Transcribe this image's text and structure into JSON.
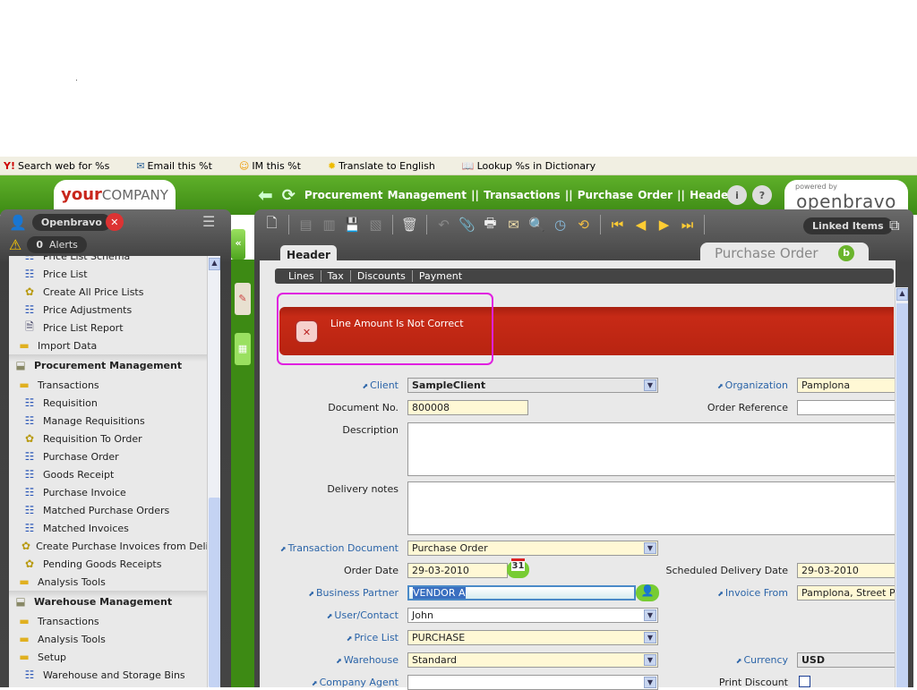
{
  "browser_toolbar": [
    {
      "icon": "yahoo-icon",
      "label": "Search web for %s"
    },
    {
      "icon": "email-icon",
      "label": "Email this %t"
    },
    {
      "icon": "smiley-icon",
      "label": "IM this %t"
    },
    {
      "icon": "translate-icon",
      "label": "Translate to English"
    },
    {
      "icon": "dictionary-icon",
      "label": "Lookup %s in Dictionary"
    }
  ],
  "header": {
    "logo_your": "your",
    "logo_company": "COMPANY",
    "breadcrumb": "Procurement Management || Transactions || Purchase Order || Header",
    "powered_by": "powered by",
    "brand": "openbravo"
  },
  "user": {
    "name": "Openbravo",
    "alerts_count": "0",
    "alerts_label": "Alerts"
  },
  "tree": [
    {
      "label": "Price List Schema",
      "type": "window",
      "level": 2
    },
    {
      "label": "Price List",
      "type": "window",
      "level": 2
    },
    {
      "label": "Create All Price Lists",
      "type": "process",
      "level": 2
    },
    {
      "label": "Price Adjustments",
      "type": "window",
      "level": 2
    },
    {
      "label": "Price List Report",
      "type": "report",
      "level": 2
    },
    {
      "label": "Import Data",
      "type": "folder",
      "level": 1
    },
    {
      "label": "Procurement Management",
      "type": "section",
      "level": 0
    },
    {
      "label": "Transactions",
      "type": "folder",
      "level": 1
    },
    {
      "label": "Requisition",
      "type": "window",
      "level": 2
    },
    {
      "label": "Manage Requisitions",
      "type": "window",
      "level": 2
    },
    {
      "label": "Requisition To Order",
      "type": "process",
      "level": 2
    },
    {
      "label": "Purchase Order",
      "type": "window",
      "level": 2
    },
    {
      "label": "Goods Receipt",
      "type": "window",
      "level": 2
    },
    {
      "label": "Purchase Invoice",
      "type": "window",
      "level": 2
    },
    {
      "label": "Matched Purchase Orders",
      "type": "window",
      "level": 2
    },
    {
      "label": "Matched Invoices",
      "type": "window",
      "level": 2
    },
    {
      "label": "Create Purchase Invoices from Deliveries",
      "type": "process",
      "level": 2
    },
    {
      "label": "Pending Goods Receipts",
      "type": "process",
      "level": 2
    },
    {
      "label": "Analysis Tools",
      "type": "folder",
      "level": 1
    },
    {
      "label": "Warehouse Management",
      "type": "section",
      "level": 0
    },
    {
      "label": "Transactions",
      "type": "folder",
      "level": 1
    },
    {
      "label": "Analysis Tools",
      "type": "folder",
      "level": 1
    },
    {
      "label": "Setup",
      "type": "folder",
      "level": 1
    },
    {
      "label": "Warehouse and Storage Bins",
      "type": "window",
      "level": 2
    }
  ],
  "toolbar": {
    "linked_items": "Linked Items"
  },
  "tabs": {
    "header": "Header",
    "window_title": "Purchase Order",
    "subtabs": [
      "Lines",
      "Tax",
      "Discounts",
      "Payment"
    ]
  },
  "message": {
    "text": "Line Amount Is Not Correct"
  },
  "form": {
    "client": {
      "label": "Client",
      "value": "SampleClient"
    },
    "organization": {
      "label": "Organization",
      "value": "Pamplona"
    },
    "document_no": {
      "label": "Document No.",
      "value": "800008"
    },
    "order_reference": {
      "label": "Order Reference",
      "value": ""
    },
    "description": {
      "label": "Description",
      "value": ""
    },
    "delivery_notes": {
      "label": "Delivery notes",
      "value": ""
    },
    "transaction_document": {
      "label": "Transaction Document",
      "value": "Purchase Order"
    },
    "order_date": {
      "label": "Order Date",
      "value": "29-03-2010"
    },
    "scheduled_delivery_date": {
      "label": "Scheduled Delivery Date",
      "value": "29-03-2010"
    },
    "business_partner": {
      "label": "Business Partner",
      "value": "VENDOR A"
    },
    "invoice_from": {
      "label": "Invoice From",
      "value": "Pamplona, Street Pur"
    },
    "user_contact": {
      "label": "User/Contact",
      "value": "John"
    },
    "price_list": {
      "label": "Price List",
      "value": "PURCHASE"
    },
    "warehouse": {
      "label": "Warehouse",
      "value": "Standard"
    },
    "currency": {
      "label": "Currency",
      "value": "USD"
    },
    "company_agent": {
      "label": "Company Agent",
      "value": ""
    },
    "print_discount": {
      "label": "Print Discount",
      "checked": false
    },
    "calendar_day": "31"
  }
}
